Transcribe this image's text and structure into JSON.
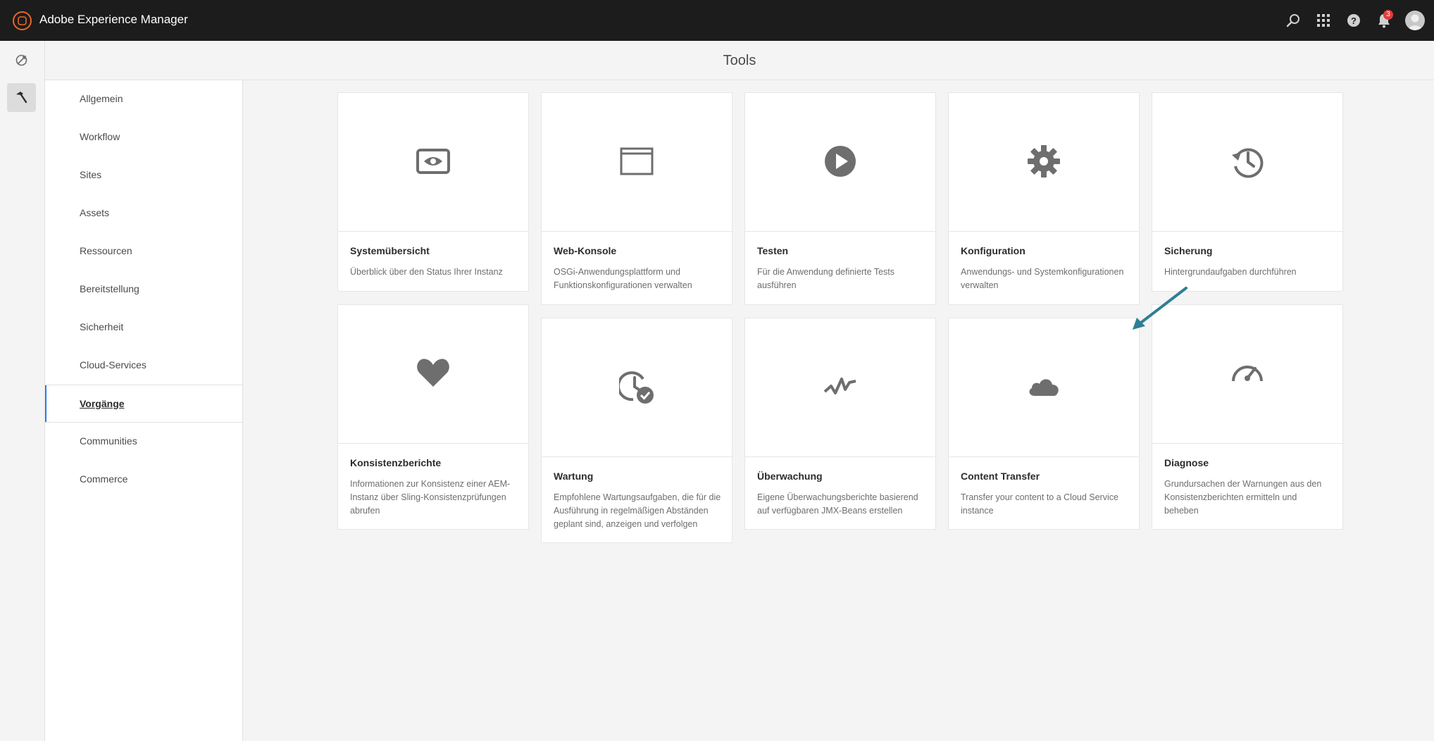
{
  "app": {
    "title": "Adobe Experience Manager",
    "notification_count": "3"
  },
  "page": {
    "title": "Tools"
  },
  "icons": {
    "logo": "aem-logo-icon",
    "search": "search-icon",
    "apps": "apps-grid-icon",
    "help": "help-icon",
    "notifications": "bell-icon",
    "rail_nav": "navigation-icon",
    "rail_tools": "hammer-icon"
  },
  "sidebar": {
    "items": [
      {
        "label": "Allgemein"
      },
      {
        "label": "Workflow"
      },
      {
        "label": "Sites"
      },
      {
        "label": "Assets"
      },
      {
        "label": "Ressourcen"
      },
      {
        "label": "Bereitstellung"
      },
      {
        "label": "Sicherheit"
      },
      {
        "label": "Cloud-Services"
      },
      {
        "label": "Vorgänge",
        "active": true
      },
      {
        "label": "Communities"
      },
      {
        "label": "Commerce"
      }
    ]
  },
  "cards": [
    {
      "title": "Systemübersicht",
      "desc": "Überblick über den Status Ihrer Instanz",
      "icon": "eye-monitor-icon"
    },
    {
      "title": "Web-Konsole",
      "desc": "OSGi-Anwendungsplattform und Funktionskonfigurationen verwalten",
      "icon": "browser-window-icon"
    },
    {
      "title": "Testen",
      "desc": "Für die Anwendung definierte Tests ausführen",
      "icon": "play-circle-icon"
    },
    {
      "title": "Konfiguration",
      "desc": "Anwendungs- und Systemkonfigurationen verwalten",
      "icon": "gear-icon"
    },
    {
      "title": "Sicherung",
      "desc": "Hintergrundaufgaben durchführen",
      "icon": "history-clock-icon"
    },
    {
      "title": "Konsistenzberichte",
      "desc": "Informationen zur Konsistenz einer AEM-Instanz über Sling-Konsistenzprüfungen abrufen",
      "icon": "heart-icon"
    },
    {
      "title": "Wartung",
      "desc": "Empfohlene Wartungsaufgaben, die für die Ausführung in regelmäßigen Abständen geplant sind, anzeigen und verfolgen",
      "icon": "clock-check-icon"
    },
    {
      "title": "Überwachung",
      "desc": "Eigene Überwachungsberichte basierend auf verfügbaren JMX-Beans erstellen",
      "icon": "pulse-icon"
    },
    {
      "title": "Content Transfer",
      "desc": "Transfer your content to a Cloud Service instance",
      "icon": "cloud-icon"
    },
    {
      "title": "Diagnose",
      "desc": "Grundursachen der Warnungen aus den Konsistenzberichten ermitteln und beheben",
      "icon": "speedometer-icon"
    }
  ],
  "annotation": {
    "color": "#2e7f93",
    "icon": "annotation-arrow"
  }
}
